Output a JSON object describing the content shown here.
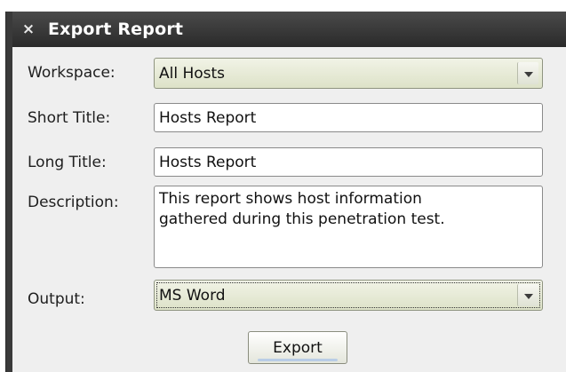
{
  "dialog": {
    "title": "Export Report",
    "close_glyph": "×"
  },
  "form": {
    "workspace_label": "Workspace:",
    "workspace_value": "All Hosts",
    "short_title_label": "Short Title:",
    "short_title_value": "Hosts Report",
    "long_title_label": "Long Title:",
    "long_title_value": "Hosts Report",
    "description_label": "Description:",
    "description_value": "This report shows host information\ngathered during this penetration test.",
    "output_label": "Output:",
    "output_value": "MS Word",
    "export_label": "Export"
  },
  "icons": {
    "close": "close-icon",
    "dropdown": "chevron-down-icon"
  }
}
